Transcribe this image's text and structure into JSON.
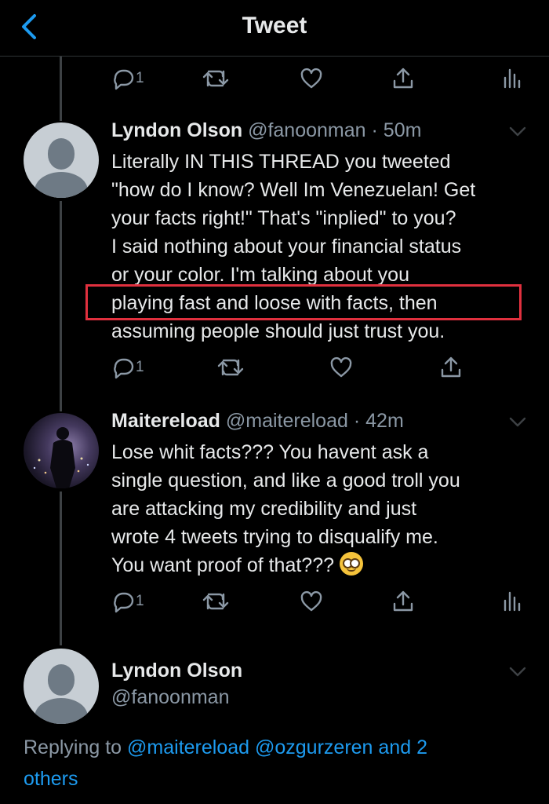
{
  "header": {
    "title": "Tweet"
  },
  "top_actions": {
    "reply_count": "1"
  },
  "tweets": [
    {
      "name": "Lyndon Olson",
      "handle": "@fanoonman",
      "time": "· 50m",
      "lines": [
        "Literally IN THIS THREAD you tweeted",
        "\"how do I know? Well Im Venezuelan! Get",
        "your facts right!\" That's \"inplied\" to you?",
        "I said nothing about your financial status",
        "or your color. I'm talking about you",
        "playing fast and loose with facts, then",
        "assuming people should just trust you."
      ],
      "reply_count": "1"
    },
    {
      "name": "Maitereload",
      "handle": "@maitereload",
      "time": "· 42m",
      "lines": [
        "Lose whit facts??? You havent ask a",
        "single question, and like a good troll you",
        "are attacking my credibility and just",
        "wrote 4 tweets trying to disqualify me.",
        "You want proof of that???"
      ],
      "emoji": "nerd-face-emoji",
      "reply_count": "1"
    }
  ],
  "main_tweet": {
    "name": "Lyndon Olson",
    "handle": "@fanoonman",
    "replying_prefix": "Replying to",
    "mention_1": "@maitereload",
    "mention_2": "@ozgurzeren",
    "and_others_line1": "and 2",
    "and_others_line2": "others"
  },
  "colors": {
    "background": "#000000",
    "text": "#e7e9ea",
    "muted": "#8b98a5",
    "accent": "#1d9bf0",
    "highlight_box": "#e0303e"
  }
}
